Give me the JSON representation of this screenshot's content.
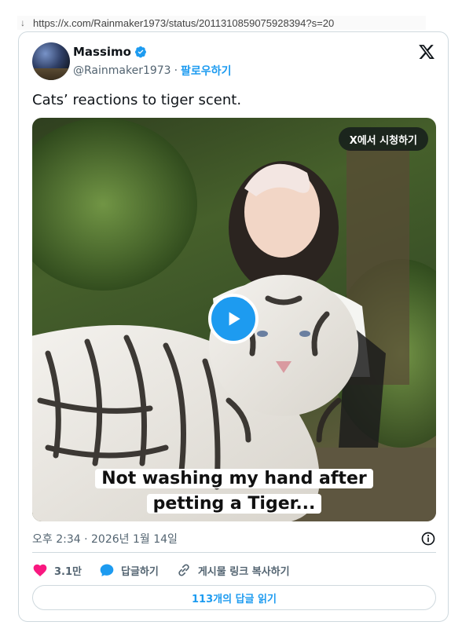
{
  "browser": {
    "url": "https://x.com/Rainmaker1973/status/2011310859075928394?s=20"
  },
  "tweet": {
    "author_name": "Massimo",
    "handle": "@Rainmaker1973",
    "separator": "·",
    "follow_label": "팔로우하기",
    "text": "Cats’ reactions to tiger scent.",
    "watch_on_x_label": "X에서 시청하기",
    "video_caption_line1": "Not washing my hand after",
    "video_caption_line2": "petting a Tiger...",
    "timestamp": "오후 2:34 · 2026년 1월 14일",
    "like_count": "3.1만",
    "reply_label": "답글하기",
    "copy_link_label": "게시물 링크 복사하기",
    "read_replies_label": "113개의 답글 읽기"
  },
  "icons": {
    "download": "download-arrow-icon",
    "verified": "verified-badge-icon",
    "x_logo": "x-logo-icon",
    "play": "play-icon",
    "info": "info-icon",
    "heart": "heart-icon",
    "reply": "reply-bubble-icon",
    "link": "link-icon"
  },
  "colors": {
    "accent": "#1d9bf0",
    "like": "#f91880",
    "text_primary": "#0f1419",
    "text_secondary": "#536471",
    "border": "#cfd9de"
  }
}
